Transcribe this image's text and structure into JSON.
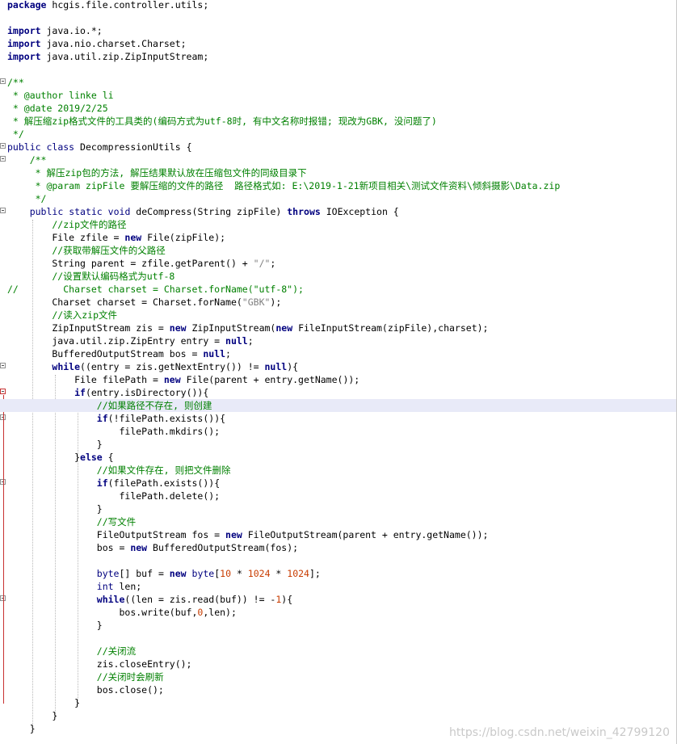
{
  "code": {
    "l1": "package hcgis.file.controller.utils;",
    "l3": "import java.io.*;",
    "l4": "import java.nio.charset.Charset;",
    "l5": "import java.util.zip.ZipInputStream;",
    "l7": "/**",
    "l8": " * @author linke li",
    "l9": " * @date 2019/2/25",
    "l10": " * 解压缩zip格式文件的工具类的(编码方式为utf-8时, 有中文名称时报错; 现改为GBK, 没问题了)",
    "l11": " */",
    "l12": "public class DecompressionUtils {",
    "l13": "    /**",
    "l14": "     * 解压zip包的方法, 解压结果默认放在压缩包文件的同级目录下",
    "l15": "     * @param zipFile 要解压缩的文件的路径  路径格式如: E:\\2019-1-21新项目相关\\测试文件资料\\倾斜摄影\\Data.zip",
    "l16": "     */",
    "l17": "    public static void deCompress(String zipFile) throws IOException {",
    "l18": "        //zip文件的路径",
    "l19": "        File zfile = new File(zipFile);",
    "l20": "        //获取带解压文件的父路径",
    "l21": "        String parent = zfile.getParent() + \"/\";",
    "l22": "        //设置默认编码格式为utf-8",
    "l23": "//        Charset charset = Charset.forName(\"utf-8\");",
    "l24": "        Charset charset = Charset.forName(\"GBK\");",
    "l25": "        //读入zip文件",
    "l26": "        ZipInputStream zis = new ZipInputStream(new FileInputStream(zipFile),charset);",
    "l27": "        java.util.zip.ZipEntry entry = null;",
    "l28": "        BufferedOutputStream bos = null;",
    "l29": "        while((entry = zis.getNextEntry()) != null){",
    "l30": "            File filePath = new File(parent + entry.getName());",
    "l31": "            if(entry.isDirectory()){",
    "l32": "                //如果路径不存在, 则创建",
    "l33": "                if(!filePath.exists()){",
    "l34": "                    filePath.mkdirs();",
    "l35": "                }",
    "l36": "            }else {",
    "l37": "                //如果文件存在, 则把文件删除",
    "l38": "                if(filePath.exists()){",
    "l39": "                    filePath.delete();",
    "l40": "                }",
    "l41": "                //写文件",
    "l42": "                FileOutputStream fos = new FileOutputStream(parent + entry.getName());",
    "l43": "                bos = new BufferedOutputStream(fos);",
    "l45": "                byte[] buf = new byte[10 * 1024 * 1024];",
    "l46": "                int len;",
    "l47": "                while((len = zis.read(buf)) != -1){",
    "l48": "                    bos.write(buf,0,len);",
    "l49": "                }",
    "l51": "                //关闭流",
    "l52": "                zis.closeEntry();",
    "l53": "                //关闭时会刷新",
    "l54": "                bos.close();",
    "l55": "            }",
    "l56": "        }",
    "l57": "    }"
  },
  "watermark": "https://blog.csdn.net/weixin_42799120",
  "colors": {
    "keyword": "#00007f",
    "comment": "#008000",
    "string": "#808080",
    "number": "#c83c00",
    "highlight": "#e8eaf8",
    "change_marker": "#c83232"
  }
}
